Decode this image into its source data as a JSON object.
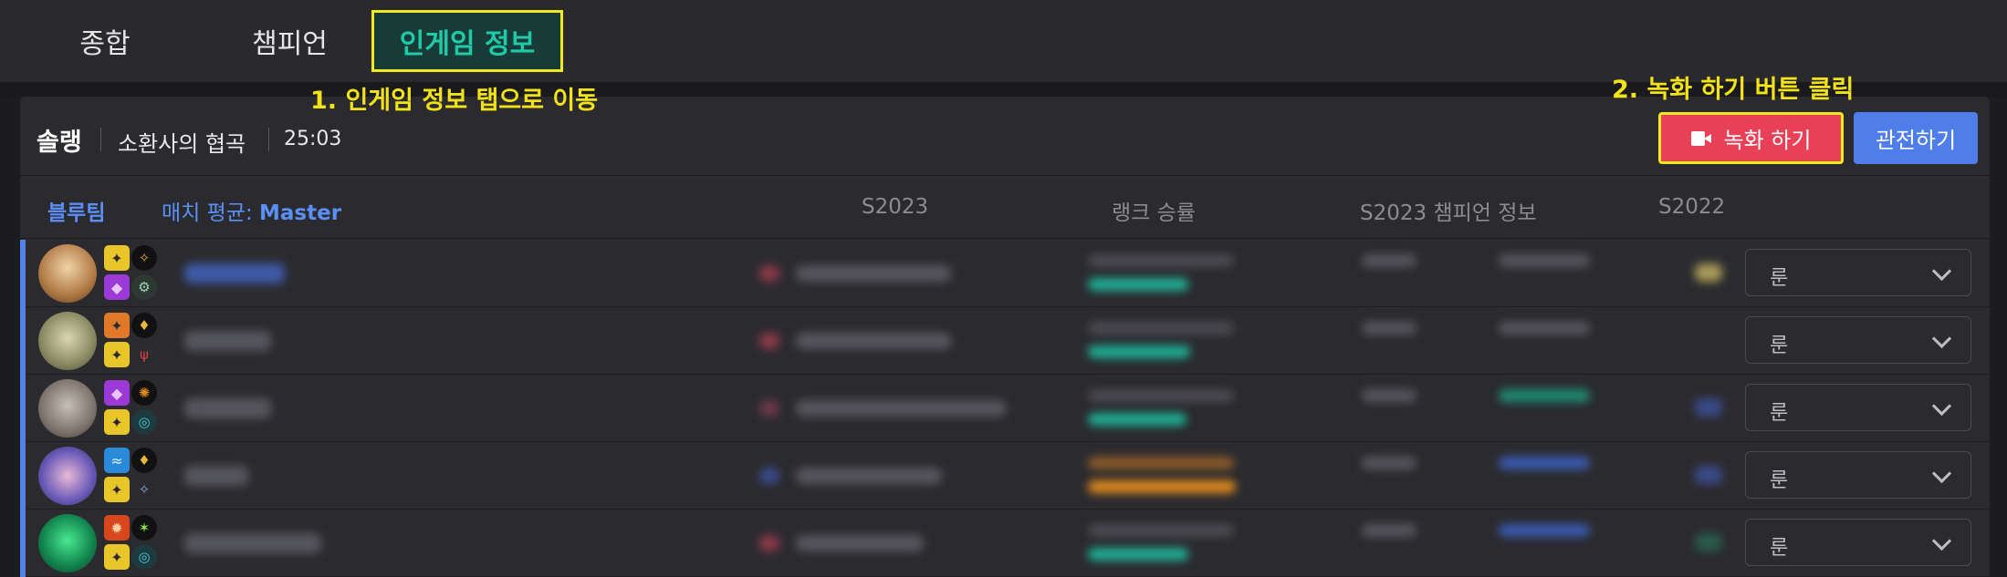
{
  "tabs": [
    {
      "label": "종합"
    },
    {
      "label": "챔피언"
    },
    {
      "label": "인게임 정보"
    }
  ],
  "annotations": {
    "step1": "1. 인게임 정보 탭으로 이동",
    "step2": "2. 녹화 하기 버튼 클릭"
  },
  "match": {
    "queue": "솔랭",
    "map": "소환사의 협곡",
    "time": "25:03",
    "record_label": "녹화 하기",
    "spectate_label": "관전하기"
  },
  "table": {
    "team": "블루팀",
    "avg_label": "매치 평균: ",
    "avg_tier": "Master",
    "columns": [
      "S2023",
      "랭크 승률",
      "S2023 챔피언 정보",
      "S2022"
    ]
  },
  "players": [
    {
      "champion_icon": "champion-portrait-icon",
      "rune_select": "룬",
      "winrate_color": "#1fae93",
      "spell_icons": [
        "flash-icon",
        "ignite-icon"
      ],
      "rune_icons": [
        "rune-primary-icon",
        "rune-secondary-icon"
      ]
    },
    {
      "champion_icon": "champion-portrait-icon",
      "rune_select": "룬",
      "winrate_color": "#1fae93",
      "spell_icons": [
        "ignite-icon",
        "flash-icon"
      ],
      "rune_icons": [
        "rune-primary-icon",
        "rune-secondary-icon"
      ]
    },
    {
      "champion_icon": "champion-portrait-icon",
      "rune_select": "룬",
      "winrate_color": "#1fae93",
      "spell_icons": [
        "teleport-icon",
        "flash-icon"
      ],
      "rune_icons": [
        "rune-primary-icon",
        "rune-secondary-icon"
      ]
    },
    {
      "champion_icon": "champion-portrait-icon",
      "rune_select": "룬",
      "winrate_color": "#e08a1e",
      "spell_icons": [
        "heal-icon",
        "flash-icon"
      ],
      "rune_icons": [
        "rune-primary-icon",
        "rune-secondary-icon"
      ]
    },
    {
      "champion_icon": "champion-portrait-icon",
      "rune_select": "룬",
      "winrate_color": "#1fae93",
      "spell_icons": [
        "smite-icon",
        "flash-icon"
      ],
      "rune_icons": [
        "rune-primary-icon",
        "rune-secondary-icon"
      ]
    }
  ],
  "colors": {
    "blue_team": "#5383e8",
    "record_button": "#e84057",
    "spectate_button": "#4f7dea",
    "active_tab_text": "#21c9a9",
    "annotation": "#f2e21a"
  }
}
